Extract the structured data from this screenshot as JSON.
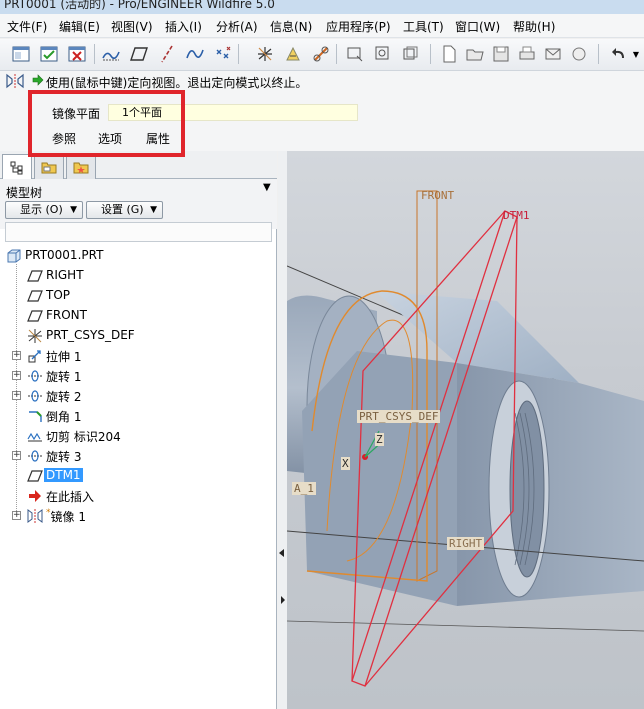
{
  "window": {
    "title": "PRT0001 (活动的) - Pro/ENGINEER Wildfire 5.0"
  },
  "menu": [
    "文件(F)",
    "编辑(E)",
    "视图(V)",
    "插入(I)",
    "分析(A)",
    "信息(N)",
    "应用程序(P)",
    "工具(T)",
    "窗口(W)",
    "帮助(H)"
  ],
  "dashboard": {
    "message": "使用(鼠标中键)定向视图。退出定向模式以终止。",
    "mirror_plane_label": "镜像平面",
    "mirror_plane_value": "1个平面",
    "tabs": [
      "参照",
      "选项",
      "属性"
    ],
    "highlight_color": "#e0252b"
  },
  "model_tree": {
    "title": "模型树",
    "show_button": "显示 (O)",
    "settings_button": "设置 (G)",
    "root": "PRT0001.PRT",
    "items": [
      {
        "label": "RIGHT",
        "icon": "datum-plane-icon"
      },
      {
        "label": "TOP",
        "icon": "datum-plane-icon"
      },
      {
        "label": "FRONT",
        "icon": "datum-plane-icon"
      },
      {
        "label": "PRT_CSYS_DEF",
        "icon": "csys-icon"
      },
      {
        "label": "拉伸 1",
        "icon": "extrude-icon"
      },
      {
        "label": "旋转 1",
        "icon": "revolve-icon"
      },
      {
        "label": "旋转 2",
        "icon": "revolve-icon"
      },
      {
        "label": "倒角 1",
        "icon": "chamfer-icon"
      },
      {
        "label": "切剪 标识204",
        "icon": "cut-icon"
      },
      {
        "label": "旋转 3",
        "icon": "revolve-icon"
      },
      {
        "label": "DTM1",
        "icon": "datum-plane-icon"
      },
      {
        "label": "在此插入",
        "icon": "insert-here-icon"
      },
      {
        "label": "镜像 1",
        "icon": "mirror-icon"
      }
    ],
    "selected_item": "DTM1"
  },
  "viewport": {
    "labels": {
      "front": "FRONT",
      "dtm1": "DTM1",
      "csys": "PRT_CSYS_DEF",
      "right": "RIGHT",
      "x": "X",
      "z": "Z",
      "a1": "A_1"
    },
    "colors": {
      "dtm1": "#e03040",
      "front": "#c8752a",
      "edge": "#2b2b2b"
    }
  }
}
